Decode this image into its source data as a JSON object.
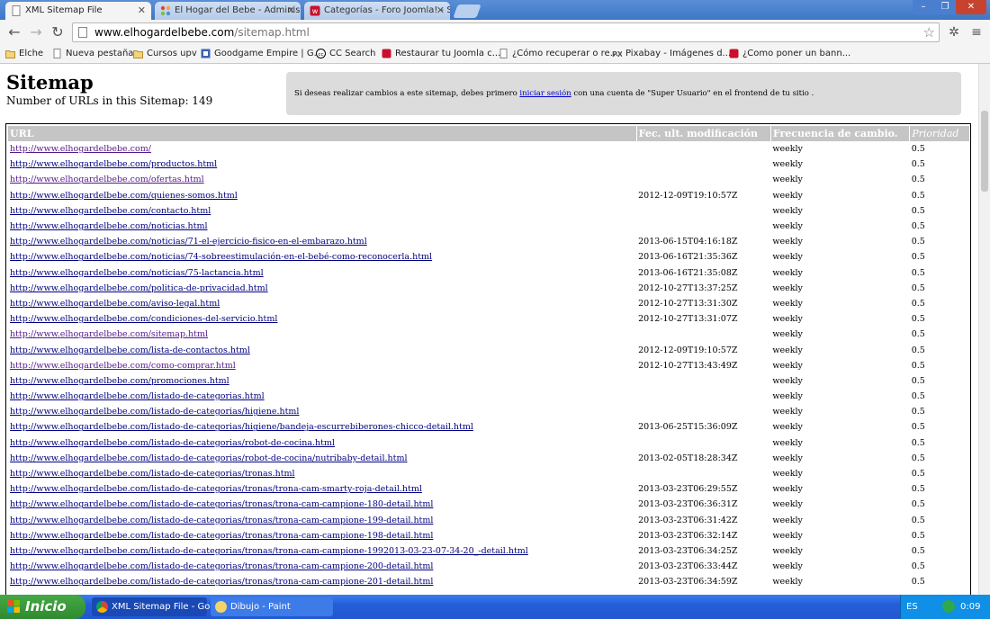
{
  "browser": {
    "tabs": [
      {
        "title": "XML Sitemap File",
        "active": true
      },
      {
        "title": "El Hogar del Bebe - Administ",
        "active": false
      },
      {
        "title": "Categorías - Foro Joomla! - S",
        "active": false
      }
    ],
    "url_host": "www.elhogardelbebe.com",
    "url_path": "/sitemap.html",
    "bookmarks": [
      "Elche",
      "Nueva pestaña",
      "Cursos upv",
      "Goodgame Empire | G...",
      "CC Search",
      "Restaurar tu Joomla c...",
      "¿Cómo recuperar o re...",
      "Pixabay - Imágenes d...",
      "¿Como poner un bann..."
    ]
  },
  "page": {
    "title": "Sitemap",
    "count_text": "Number of URLs in this Sitemap: 149",
    "notice_before": "Si deseas realizar cambios a este sitemap, debes primero",
    "notice_link": "iniciar sesión",
    "notice_after": "con una cuenta de \"Super Usuario\" en el frontend de tu sitio .",
    "headers": [
      "URL",
      "Fec. ult. modificación",
      "Frecuencia de cambio.",
      "Prioridad"
    ],
    "rows": [
      {
        "url": "http://www.elhogardelbebe.com/",
        "date": "",
        "freq": "weekly",
        "prio": "0.5",
        "visited": true
      },
      {
        "url": "http://www.elhogardelbebe.com/productos.html",
        "date": "",
        "freq": "weekly",
        "prio": "0.5",
        "visited": false
      },
      {
        "url": "http://www.elhogardelbebe.com/ofertas.html",
        "date": "",
        "freq": "weekly",
        "prio": "0.5",
        "visited": true
      },
      {
        "url": "http://www.elhogardelbebe.com/quienes-somos.html",
        "date": "2012-12-09T19:10:57Z",
        "freq": "weekly",
        "prio": "0.5",
        "visited": false
      },
      {
        "url": "http://www.elhogardelbebe.com/contacto.html",
        "date": "",
        "freq": "weekly",
        "prio": "0.5",
        "visited": false
      },
      {
        "url": "http://www.elhogardelbebe.com/noticias.html",
        "date": "",
        "freq": "weekly",
        "prio": "0.5",
        "visited": false
      },
      {
        "url": "http://www.elhogardelbebe.com/noticias/71-el-ejercicio-fisico-en-el-embarazo.html",
        "date": "2013-06-15T04:16:18Z",
        "freq": "weekly",
        "prio": "0.5",
        "visited": false
      },
      {
        "url": "http://www.elhogardelbebe.com/noticias/74-sobreestimulación-en-el-bebé-como-reconocerla.html",
        "date": "2013-06-16T21:35:36Z",
        "freq": "weekly",
        "prio": "0.5",
        "visited": false
      },
      {
        "url": "http://www.elhogardelbebe.com/noticias/75-lactancia.html",
        "date": "2013-06-16T21:35:08Z",
        "freq": "weekly",
        "prio": "0.5",
        "visited": false
      },
      {
        "url": "http://www.elhogardelbebe.com/politica-de-privacidad.html",
        "date": "2012-10-27T13:37:25Z",
        "freq": "weekly",
        "prio": "0.5",
        "visited": false
      },
      {
        "url": "http://www.elhogardelbebe.com/aviso-legal.html",
        "date": "2012-10-27T13:31:30Z",
        "freq": "weekly",
        "prio": "0.5",
        "visited": false
      },
      {
        "url": "http://www.elhogardelbebe.com/condiciones-del-servicio.html",
        "date": "2012-10-27T13:31:07Z",
        "freq": "weekly",
        "prio": "0.5",
        "visited": false
      },
      {
        "url": "http://www.elhogardelbebe.com/sitemap.html",
        "date": "",
        "freq": "weekly",
        "prio": "0.5",
        "visited": true
      },
      {
        "url": "http://www.elhogardelbebe.com/lista-de-contactos.html",
        "date": "2012-12-09T19:10:57Z",
        "freq": "weekly",
        "prio": "0.5",
        "visited": false
      },
      {
        "url": "http://www.elhogardelbebe.com/como-comprar.html",
        "date": "2012-10-27T13:43:49Z",
        "freq": "weekly",
        "prio": "0.5",
        "visited": true
      },
      {
        "url": "http://www.elhogardelbebe.com/promociones.html",
        "date": "",
        "freq": "weekly",
        "prio": "0.5",
        "visited": false
      },
      {
        "url": "http://www.elhogardelbebe.com/listado-de-categorias.html",
        "date": "",
        "freq": "weekly",
        "prio": "0.5",
        "visited": false
      },
      {
        "url": "http://www.elhogardelbebe.com/listado-de-categorias/higiene.html",
        "date": "",
        "freq": "weekly",
        "prio": "0.5",
        "visited": false
      },
      {
        "url": "http://www.elhogardelbebe.com/listado-de-categorias/higiene/bandeja-escurrebiberones-chicco-detail.html",
        "date": "2013-06-25T15:36:09Z",
        "freq": "weekly",
        "prio": "0.5",
        "visited": false
      },
      {
        "url": "http://www.elhogardelbebe.com/listado-de-categorias/robot-de-cocina.html",
        "date": "",
        "freq": "weekly",
        "prio": "0.5",
        "visited": false
      },
      {
        "url": "http://www.elhogardelbebe.com/listado-de-categorias/robot-de-cocina/nutribaby-detail.html",
        "date": "2013-02-05T18:28:34Z",
        "freq": "weekly",
        "prio": "0.5",
        "visited": false
      },
      {
        "url": "http://www.elhogardelbebe.com/listado-de-categorias/tronas.html",
        "date": "",
        "freq": "weekly",
        "prio": "0.5",
        "visited": false
      },
      {
        "url": "http://www.elhogardelbebe.com/listado-de-categorias/tronas/trona-cam-smarty-roja-detail.html",
        "date": "2013-03-23T06:29:55Z",
        "freq": "weekly",
        "prio": "0.5",
        "visited": false
      },
      {
        "url": "http://www.elhogardelbebe.com/listado-de-categorias/tronas/trona-cam-campione-180-detail.html",
        "date": "2013-03-23T06:36:31Z",
        "freq": "weekly",
        "prio": "0.5",
        "visited": false
      },
      {
        "url": "http://www.elhogardelbebe.com/listado-de-categorias/tronas/trona-cam-campione-199-detail.html",
        "date": "2013-03-23T06:31:42Z",
        "freq": "weekly",
        "prio": "0.5",
        "visited": false
      },
      {
        "url": "http://www.elhogardelbebe.com/listado-de-categorias/tronas/trona-cam-campione-198-detail.html",
        "date": "2013-03-23T06:32:14Z",
        "freq": "weekly",
        "prio": "0.5",
        "visited": false
      },
      {
        "url": "http://www.elhogardelbebe.com/listado-de-categorias/tronas/trona-cam-campione-1992013-03-23-07-34-20_-detail.html",
        "date": "2013-03-23T06:34:25Z",
        "freq": "weekly",
        "prio": "0.5",
        "visited": false
      },
      {
        "url": "http://www.elhogardelbebe.com/listado-de-categorias/tronas/trona-cam-campione-200-detail.html",
        "date": "2013-03-23T06:33:44Z",
        "freq": "weekly",
        "prio": "0.5",
        "visited": false
      },
      {
        "url": "http://www.elhogardelbebe.com/listado-de-categorias/tronas/trona-cam-campione-201-detail.html",
        "date": "2013-03-23T06:34:59Z",
        "freq": "weekly",
        "prio": "0.5",
        "visited": false
      }
    ]
  },
  "taskbar": {
    "start_label": "Inicio",
    "tasks": [
      "XML Sitemap File - Go...",
      "Dibujo - Paint"
    ],
    "lang": "ES",
    "clock": "0:09"
  },
  "colors": {
    "link": "#000080",
    "visited": "#551a8b",
    "header_bg": "#c5c5c5",
    "taskbar": "#2257d1",
    "start": "#3a9a3a"
  }
}
